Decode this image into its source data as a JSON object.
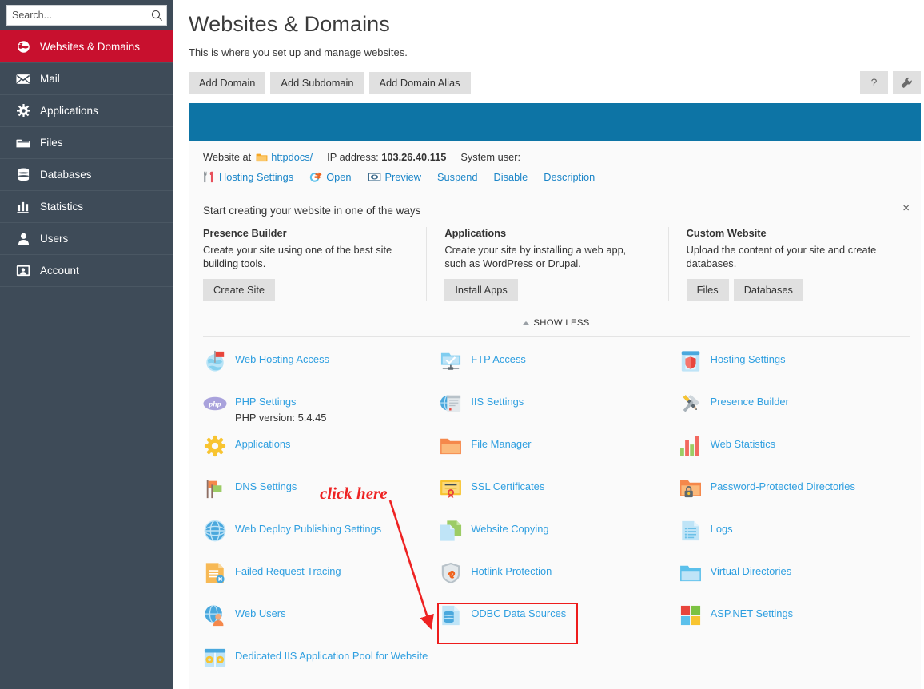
{
  "colors": {
    "sidebar_bg": "#3e4b58",
    "sidebar_active": "#c8102e",
    "banner_blue": "#0d74a5",
    "link_blue": "#2f9fe0",
    "annotation_red": "#ee2222",
    "panel_bg": "#fafafa"
  },
  "sidebar": {
    "search": {
      "placeholder": "Search...",
      "value": ""
    },
    "items": [
      {
        "label": "Websites & Domains",
        "icon": "globe-icon",
        "active": true
      },
      {
        "label": "Mail",
        "icon": "envelope-icon",
        "active": false
      },
      {
        "label": "Applications",
        "icon": "gear-icon",
        "active": false
      },
      {
        "label": "Files",
        "icon": "folder-icon",
        "active": false
      },
      {
        "label": "Databases",
        "icon": "database-icon",
        "active": false
      },
      {
        "label": "Statistics",
        "icon": "bar-chart-icon",
        "active": false
      },
      {
        "label": "Users",
        "icon": "user-icon",
        "active": false
      },
      {
        "label": "Account",
        "icon": "id-card-icon",
        "active": false
      }
    ]
  },
  "header": {
    "title": "Websites & Domains",
    "subtitle": "This is where you set up and manage websites.",
    "buttons": [
      "Add Domain",
      "Add Subdomain",
      "Add Domain Alias"
    ],
    "help_label": "?",
    "wrench_label": "wrench-icon"
  },
  "site": {
    "website_at_label": "Website at",
    "docroot": "httpdocs/",
    "ip_label": "IP address:",
    "ip_value": "103.26.40.115",
    "system_user_label": "System user:",
    "system_user_value": "",
    "actions": [
      {
        "label": "Hosting Settings",
        "icon": "tools-icon"
      },
      {
        "label": "Open",
        "icon": "open-arrow-icon"
      },
      {
        "label": "Preview",
        "icon": "preview-eye-icon"
      },
      {
        "label": "Suspend",
        "icon": ""
      },
      {
        "label": "Disable",
        "icon": ""
      },
      {
        "label": "Description",
        "icon": ""
      }
    ]
  },
  "promo": {
    "title": "Start creating your website in one of the ways",
    "close_label": "×",
    "columns": [
      {
        "heading": "Presence Builder",
        "text": "Create your site using one of the best site building tools.",
        "buttons": [
          "Create Site"
        ]
      },
      {
        "heading": "Applications",
        "text": "Create your site by installing a web app, such as WordPress or Drupal.",
        "buttons": [
          "Install Apps"
        ]
      },
      {
        "heading": "Custom Website",
        "text": "Upload the content of your site and create databases.",
        "buttons": [
          "Files",
          "Databases"
        ]
      }
    ],
    "show_less": "SHOW LESS"
  },
  "grid": {
    "column1": [
      {
        "title": "Web Hosting Access",
        "sub": "",
        "icon": "globe-flag-icon"
      },
      {
        "title": "PHP Settings",
        "sub": "PHP version: 5.4.45",
        "icon": "php-icon"
      },
      {
        "title": "Applications",
        "sub": "",
        "icon": "gear-yellow-icon"
      },
      {
        "title": "DNS Settings",
        "sub": "",
        "icon": "flags-icon"
      },
      {
        "title": "Web Deploy Publishing Settings",
        "sub": "",
        "icon": "globe-mesh-icon"
      },
      {
        "title": "Failed Request Tracing",
        "sub": "",
        "icon": "doc-error-icon"
      },
      {
        "title": "Web Users",
        "sub": "",
        "icon": "globe-user-icon"
      },
      {
        "title": "Dedicated IIS Application Pool for Website",
        "sub": "",
        "icon": "app-pool-icon"
      }
    ],
    "column2": [
      {
        "title": "FTP Access",
        "sub": "",
        "icon": "ftp-icon"
      },
      {
        "title": "IIS Settings",
        "sub": "",
        "icon": "iis-server-icon"
      },
      {
        "title": "File Manager",
        "sub": "",
        "icon": "folder-orange-icon"
      },
      {
        "title": "SSL Certificates",
        "sub": "",
        "icon": "certificate-icon"
      },
      {
        "title": "Website Copying",
        "sub": "",
        "icon": "copy-pages-icon"
      },
      {
        "title": "Hotlink Protection",
        "sub": "",
        "icon": "shield-link-icon"
      },
      {
        "title": "ODBC Data Sources",
        "sub": "",
        "icon": "odbc-database-icon",
        "highlighted": true
      }
    ],
    "column3": [
      {
        "title": "Hosting Settings",
        "sub": "",
        "icon": "hosting-shield-icon"
      },
      {
        "title": "Presence Builder",
        "sub": "",
        "icon": "pencil-hammer-icon"
      },
      {
        "title": "Web Statistics",
        "sub": "",
        "icon": "stats-bars-icon"
      },
      {
        "title": "Password-Protected Directories",
        "sub": "",
        "icon": "folder-lock-icon"
      },
      {
        "title": "Logs",
        "sub": "",
        "icon": "log-doc-icon"
      },
      {
        "title": "Virtual Directories",
        "sub": "",
        "icon": "folder-blue-icon"
      },
      {
        "title": "ASP.NET Settings",
        "sub": "",
        "icon": "windows-squares-icon"
      }
    ]
  },
  "annotation": {
    "text": "click here"
  }
}
